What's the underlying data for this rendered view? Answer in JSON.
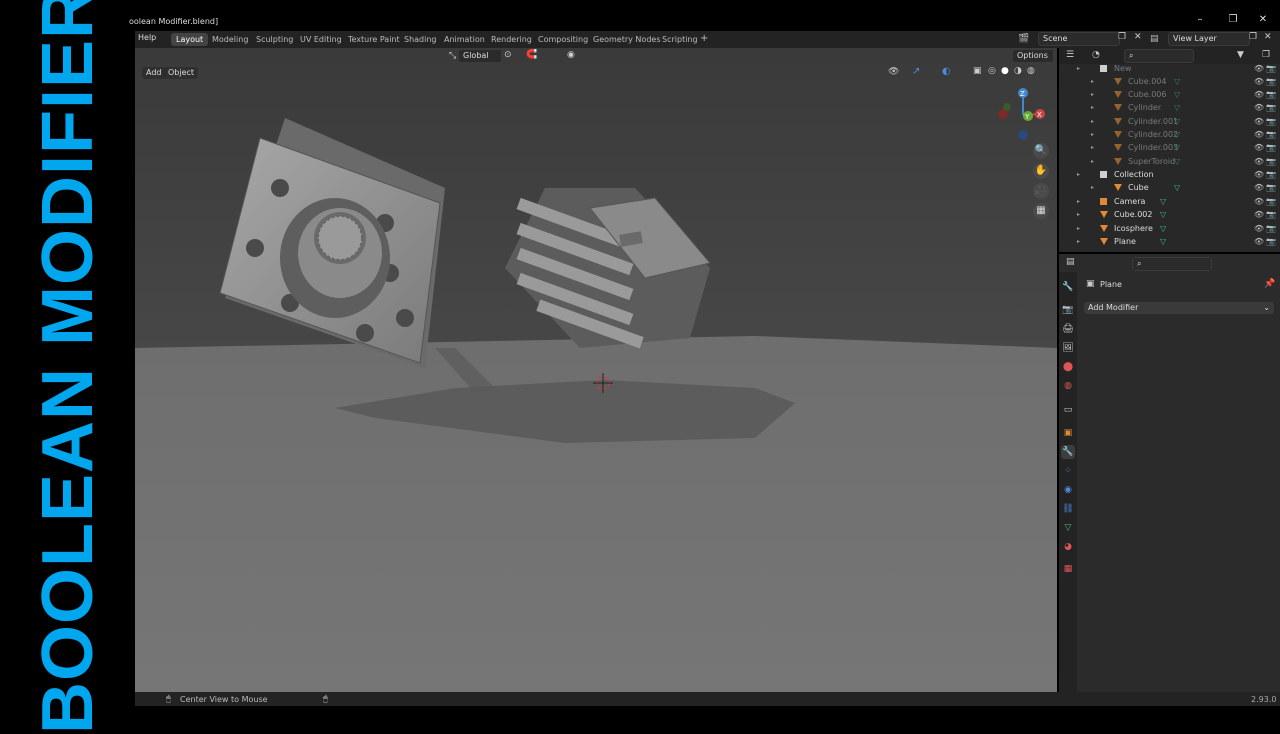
{
  "banner": {
    "text": "BOOLEAN MODIFIER",
    "color": "#00a6ee"
  },
  "window": {
    "title": "oolean Modifier.blend]"
  },
  "menubar": {
    "help": "Help"
  },
  "workspaces": [
    "Layout",
    "Modeling",
    "Sculpting",
    "UV Editing",
    "Texture Paint",
    "Shading",
    "Animation",
    "Rendering",
    "Compositing",
    "Geometry Nodes",
    "Scripting"
  ],
  "active_workspace": "Layout",
  "add_workspace": "+",
  "scene": {
    "name": "Scene"
  },
  "view_layer": {
    "name": "View Layer"
  },
  "viewport": {
    "add_menu": "Add",
    "object_menu": "Object",
    "orientation": "Global",
    "options": "Options"
  },
  "gizmo": {
    "x": "X",
    "y": "Y",
    "z": "Z"
  },
  "outliner": {
    "rows": [
      {
        "name": "New",
        "dim": true
      },
      {
        "name": "Cube.004",
        "dim": true
      },
      {
        "name": "Cube.006",
        "dim": true
      },
      {
        "name": "Cylinder",
        "dim": true
      },
      {
        "name": "Cylinder.001",
        "dim": true
      },
      {
        "name": "Cylinder.002",
        "dim": true
      },
      {
        "name": "Cylinder.003",
        "dim": true
      },
      {
        "name": "SuperToroid",
        "dim": true
      },
      {
        "name": "Collection",
        "dim": false
      },
      {
        "name": "Cube",
        "dim": false
      },
      {
        "name": "Camera",
        "dim": false
      },
      {
        "name": "Cube.002",
        "dim": false
      },
      {
        "name": "Icosphere",
        "dim": false
      },
      {
        "name": "Plane",
        "dim": false
      }
    ]
  },
  "properties": {
    "object_name": "Plane",
    "add_modifier": "Add Modifier"
  },
  "status": {
    "hint": "Center View to Mouse",
    "version": "2.93.0"
  },
  "colors": {
    "accent_orange": "#e08a33",
    "mesh_green": "#3fbf7f",
    "viewport_bg": "#3d3d3d"
  }
}
